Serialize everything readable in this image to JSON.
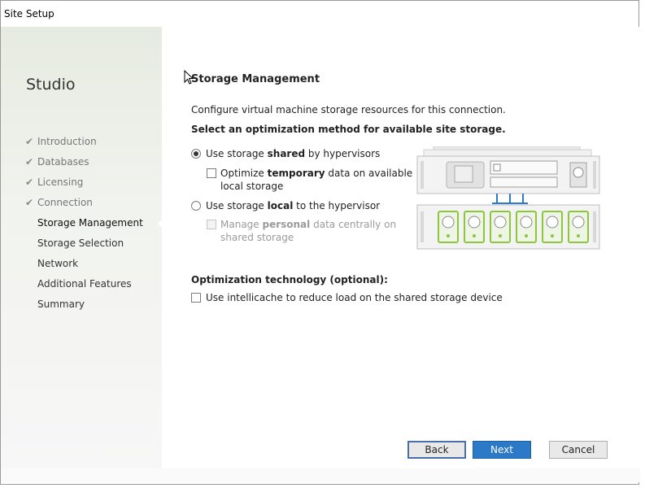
{
  "window": {
    "title": "Site Setup"
  },
  "sidebar": {
    "brand": "Studio",
    "steps": [
      {
        "label": "Introduction",
        "state": "done"
      },
      {
        "label": "Databases",
        "state": "done"
      },
      {
        "label": "Licensing",
        "state": "done"
      },
      {
        "label": "Connection",
        "state": "done"
      },
      {
        "label": "Storage Management",
        "state": "current"
      },
      {
        "label": "Storage Selection",
        "state": "pending"
      },
      {
        "label": "Network",
        "state": "pending"
      },
      {
        "label": "Additional Features",
        "state": "pending"
      },
      {
        "label": "Summary",
        "state": "pending"
      }
    ]
  },
  "main": {
    "heading": "Storage Management",
    "description": "Configure virtual machine storage resources for this connection.",
    "method_label": "Select an optimization method for available site storage.",
    "options": {
      "shared": {
        "pre": "Use storage ",
        "bold": "shared",
        "post": " by hypervisors",
        "selected": true
      },
      "temporary": {
        "pre": "Optimize ",
        "bold": "temporary",
        "post": " data on available",
        "line2": "local storage",
        "checked": false
      },
      "local": {
        "pre": "Use storage ",
        "bold": "local",
        "post": " to the hypervisor",
        "selected": false
      },
      "personal": {
        "pre": "Manage ",
        "bold": "personal",
        "post": " data centrally on",
        "line2": "shared storage",
        "checked": false,
        "disabled": true
      }
    },
    "optimization_heading": "Optimization technology (optional):",
    "intellicache_label": "Use intellicache to reduce load on the shared storage device",
    "intellicache_checked": false
  },
  "buttons": {
    "back": "Back",
    "next": "Next",
    "cancel": "Cancel"
  },
  "colors": {
    "primary": "#2b79c7",
    "accent_green": "#8cc63f",
    "connector_blue": "#2b79c7"
  }
}
